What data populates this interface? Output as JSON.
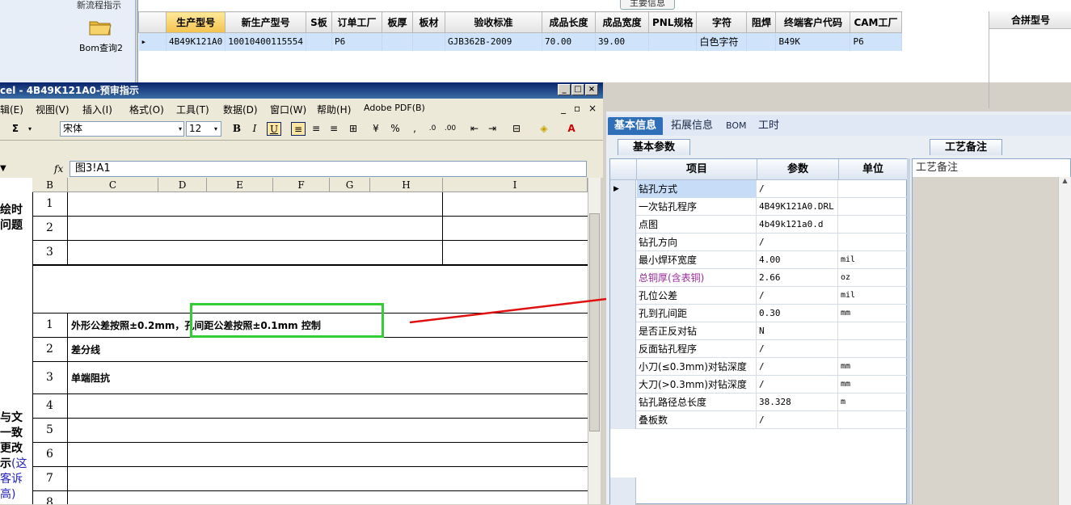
{
  "launcher": {
    "top_label": "新流程指示",
    "bom_label": "Bom查询2"
  },
  "top_grid": {
    "caption": "主要信息",
    "columns": [
      "生产型号",
      "新生产型号",
      "S板",
      "订单工厂",
      "板厚",
      "板材",
      "验收标准",
      "成品长度",
      "成品宽度",
      "PNL规格",
      "字符",
      "阻焊",
      "终端客户代码",
      "CAM工厂"
    ],
    "row": [
      "4B49K121A0",
      "10010400115554",
      "",
      "P6",
      "",
      "",
      "GJB362B-2009",
      "70.00",
      "39.00",
      "",
      "白色字符",
      "",
      "B49K",
      "P6"
    ],
    "right_header": "合拼型号"
  },
  "excel": {
    "title": "cel - 4B49K121A0-预审指示",
    "menu": [
      "辑(E)",
      "视图(V)",
      "插入(I)",
      "格式(O)",
      "工具(T)",
      "数据(D)",
      "窗口(W)",
      "帮助(H)",
      "Adobe PDF(B)"
    ],
    "font_name": "宋体",
    "font_size": "12",
    "formula": "图3!A1",
    "columns": [
      "B",
      "C",
      "D",
      "E",
      "F",
      "G",
      "H",
      "I"
    ],
    "side_text_top": [
      "绘时",
      "问题"
    ],
    "side_text_bottom": [
      "与文",
      "一致",
      "更改",
      "示"
    ],
    "side_text_blue": [
      "(这",
      "客诉",
      "高)"
    ],
    "rows_group1": [
      "1",
      "2",
      "3"
    ],
    "rows_group2": [
      {
        "n": "1",
        "text": "外形公差按照±0.2mm，孔间距公差按照±0.1mm 控制"
      },
      {
        "n": "2",
        "text": "差分线"
      },
      {
        "n": "3",
        "text": "单端阻抗"
      },
      {
        "n": "4",
        "text": ""
      },
      {
        "n": "5",
        "text": ""
      },
      {
        "n": "6",
        "text": ""
      },
      {
        "n": "7",
        "text": ""
      },
      {
        "n": "8",
        "text": ""
      }
    ]
  },
  "right_panel": {
    "tabs": [
      "基本信息",
      "拓展信息",
      "BOM",
      "工时"
    ],
    "subtab": "基本参数",
    "notes_tab": "工艺备注",
    "notes_header": "工艺备注",
    "headers": [
      "项目",
      "参数",
      "单位"
    ],
    "params": [
      {
        "name": "钻孔方式",
        "value": "/",
        "unit": ""
      },
      {
        "name": "一次钻孔程序",
        "value": "4B49K121A0.DRL",
        "unit": ""
      },
      {
        "name": "点图",
        "value": "4b49k121a0.d",
        "unit": ""
      },
      {
        "name": "钻孔方向",
        "value": "/",
        "unit": ""
      },
      {
        "name": "最小焊环宽度",
        "value": "4.00",
        "unit": "mil"
      },
      {
        "name": "总铜厚(含表铜)",
        "value": "2.66",
        "unit": "oz"
      },
      {
        "name": "孔位公差",
        "value": "/",
        "unit": "mil"
      },
      {
        "name": "孔到孔间距",
        "value": "0.30",
        "unit": "mm"
      },
      {
        "name": "是否正反对钻",
        "value": "N",
        "unit": ""
      },
      {
        "name": "反面钻孔程序",
        "value": "/",
        "unit": ""
      },
      {
        "name": "小刀(≤0.3mm)对钻深度",
        "value": "/",
        "unit": "mm"
      },
      {
        "name": "大刀(>0.3mm)对钻深度",
        "value": "/",
        "unit": "mm"
      },
      {
        "name": "钻孔路径总长度",
        "value": "38.328",
        "unit": "m"
      },
      {
        "name": "叠板数",
        "value": "/",
        "unit": ""
      }
    ]
  }
}
